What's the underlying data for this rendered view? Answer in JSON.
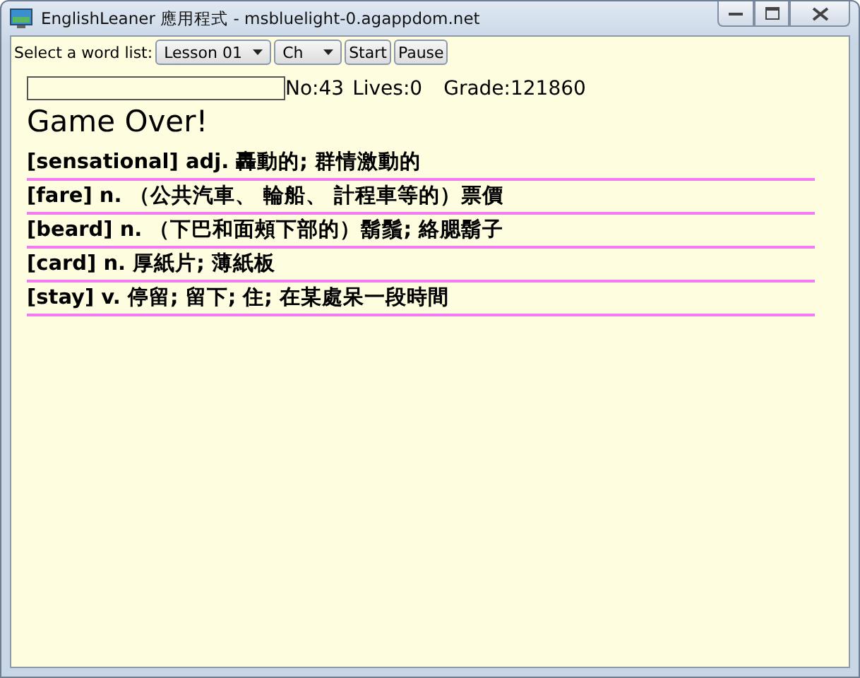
{
  "window": {
    "title": "EnglishLeaner 應用程式 - msbluelight-0.agappdom.net"
  },
  "toolbar": {
    "label": "Select a word list:",
    "selects": [
      {
        "value": "Lesson 01"
      },
      {
        "value": "Ch"
      }
    ],
    "buttons": [
      "Start",
      "Pause"
    ]
  },
  "stats": [
    "No:43",
    "Lives:0",
    "Grade:121860"
  ],
  "message": "Game Over!",
  "words": [
    "[sensational] adj. 轟動的; 群情激動的",
    "[fare] n. （公共汽車、 輪船、 計程車等的）票價",
    "[beard] n. （下巴和面頰下部的）鬍鬚; 絡腮鬍子",
    "[card] n. 厚紙片; 薄紙板",
    "[stay] v. 停留; 留下; 住; 在某處呆一段時間"
  ]
}
